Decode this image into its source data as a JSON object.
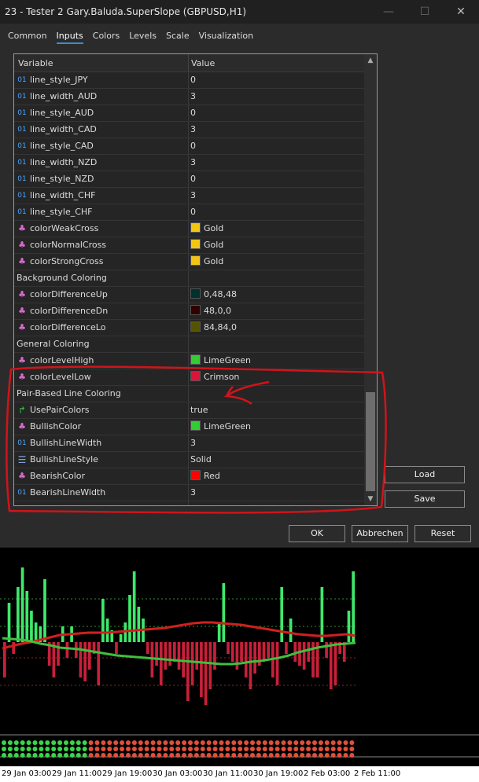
{
  "window": {
    "title": "23 - Tester 2 Gary.Baluda.SuperSlope (GBPUSD,H1)",
    "minimize": "—",
    "maximize": "☐",
    "close": "✕"
  },
  "tabs": [
    "Common",
    "Inputs",
    "Colors",
    "Levels",
    "Scale",
    "Visualization"
  ],
  "active_tab": "Inputs",
  "grid": {
    "header": {
      "variable": "Variable",
      "value": "Value"
    },
    "rows": [
      {
        "type": "int",
        "label": "line_style_JPY",
        "value": "0"
      },
      {
        "type": "int",
        "label": "line_width_AUD",
        "value": "3"
      },
      {
        "type": "int",
        "label": "line_style_AUD",
        "value": "0"
      },
      {
        "type": "int",
        "label": "line_width_CAD",
        "value": "3"
      },
      {
        "type": "int",
        "label": "line_style_CAD",
        "value": "0"
      },
      {
        "type": "int",
        "label": "line_width_NZD",
        "value": "3"
      },
      {
        "type": "int",
        "label": "line_style_NZD",
        "value": "0"
      },
      {
        "type": "int",
        "label": "line_width_CHF",
        "value": "3"
      },
      {
        "type": "int",
        "label": "line_style_CHF",
        "value": "0"
      },
      {
        "type": "color",
        "label": "colorWeakCross",
        "value": "Gold",
        "swatch": "#f2c515"
      },
      {
        "type": "color",
        "label": "colorNormalCross",
        "value": "Gold",
        "swatch": "#f2c515"
      },
      {
        "type": "color",
        "label": "colorStrongCross",
        "value": "Gold",
        "swatch": "#f2c515"
      },
      {
        "type": "group",
        "label": "Background Coloring",
        "value": ""
      },
      {
        "type": "color",
        "label": "colorDifferenceUp",
        "value": "0,48,48",
        "swatch": "#003030"
      },
      {
        "type": "color",
        "label": "colorDifferenceDn",
        "value": "48,0,0",
        "swatch": "#300000"
      },
      {
        "type": "color",
        "label": "colorDifferenceLo",
        "value": "84,84,0",
        "swatch": "#545400"
      },
      {
        "type": "group",
        "label": "General Coloring",
        "value": ""
      },
      {
        "type": "color",
        "label": "colorLevelHigh",
        "value": "LimeGreen",
        "swatch": "#32cd32"
      },
      {
        "type": "color",
        "label": "colorLevelLow",
        "value": "Crimson",
        "swatch": "#dc143c"
      },
      {
        "type": "group",
        "label": "Pair-Based Line Coloring",
        "value": ""
      },
      {
        "type": "bool",
        "label": "UsePairColors",
        "value": "true"
      },
      {
        "type": "color",
        "label": "BullishColor",
        "value": "LimeGreen",
        "swatch": "#32cd32"
      },
      {
        "type": "int",
        "label": "BullishLineWidth",
        "value": "3"
      },
      {
        "type": "list",
        "label": "BullishLineStyle",
        "value": "Solid"
      },
      {
        "type": "color",
        "label": "BearishColor",
        "value": "Red",
        "swatch": "#ff0000"
      },
      {
        "type": "int",
        "label": "BearishLineWidth",
        "value": "3"
      },
      {
        "type": "list",
        "label": "BearishLineStyle",
        "value": "Solid"
      }
    ]
  },
  "buttons": {
    "load": "Load",
    "save": "Save",
    "ok": "OK",
    "cancel": "Abbrechen",
    "reset": "Reset"
  },
  "icons": {
    "int": "01",
    "color": "palette-icon",
    "bool": "bool-arrow-icon",
    "list": "list-icon"
  },
  "annotation_color": "#d0141a",
  "chart_data": {
    "type": "bar",
    "series": [
      {
        "values": [
          -0.45,
          0.5,
          -0.15,
          0.7,
          0.95,
          0.65,
          0.4,
          0.25,
          0.2,
          0.8,
          -0.3,
          -0.45,
          -0.3,
          0.2,
          -0.2,
          0.2,
          -0.2,
          -0.45,
          -0.5,
          -0.35,
          -0.15,
          -0.55,
          0.55,
          0.3,
          0.15,
          -0.15,
          0.1,
          0.25,
          0.6,
          0.9,
          0.45,
          0.3,
          -0.15,
          -0.45,
          -0.3,
          -0.55,
          -0.35,
          -0.3,
          -0.25,
          -0.35,
          -0.45,
          -0.75,
          -0.55,
          -0.35,
          -0.7,
          -0.8,
          -0.6,
          -0.35,
          0.25,
          0.75,
          -0.15,
          -0.25,
          -0.35,
          -0.25,
          -0.45,
          -0.6,
          -0.4,
          -0.3,
          -0.25,
          -0.2,
          -0.45,
          -0.55,
          0.7,
          -0.15,
          0.3,
          -0.25,
          -0.3,
          -0.35,
          -0.25,
          -0.45,
          -0.45,
          0.7,
          -0.2,
          -0.6,
          -0.55,
          -0.15,
          -0.25,
          0.4,
          0.9
        ]
      }
    ],
    "lines": [
      {
        "color": "#d21f1f",
        "values": [
          -0.08,
          -0.05,
          -0.02,
          0.0,
          0.03,
          0.06,
          0.09,
          0.1,
          0.11,
          0.12,
          0.12,
          0.12,
          0.13,
          0.14,
          0.15,
          0.16,
          0.17,
          0.18,
          0.2,
          0.22,
          0.24,
          0.25,
          0.25,
          0.24,
          0.23,
          0.22,
          0.2,
          0.18,
          0.16,
          0.14,
          0.12,
          0.1,
          0.09,
          0.08,
          0.08,
          0.09,
          0.1,
          0.08
        ]
      },
      {
        "color": "#3fbf3f",
        "values": [
          0.05,
          0.04,
          0.03,
          0.01,
          -0.02,
          -0.04,
          -0.07,
          -0.08,
          -0.09,
          -0.11,
          -0.13,
          -0.15,
          -0.17,
          -0.18,
          -0.19,
          -0.2,
          -0.21,
          -0.22,
          -0.23,
          -0.24,
          -0.25,
          -0.26,
          -0.27,
          -0.28,
          -0.28,
          -0.27,
          -0.25,
          -0.24,
          -0.22,
          -0.2,
          -0.17,
          -0.13,
          -0.1,
          -0.07,
          -0.05,
          -0.03,
          -0.02,
          -0.01
        ]
      }
    ],
    "levels": [
      0.55,
      0.2,
      -0.2,
      -0.55
    ],
    "dot_rows": 3,
    "x_labels": [
      "29 Jan 03:00",
      "29 Jan 11:00",
      "29 Jan 19:00",
      "30 Jan 03:00",
      "30 Jan 11:00",
      "30 Jan 19:00",
      "2 Feb 03:00",
      "2 Feb 11:00"
    ]
  }
}
